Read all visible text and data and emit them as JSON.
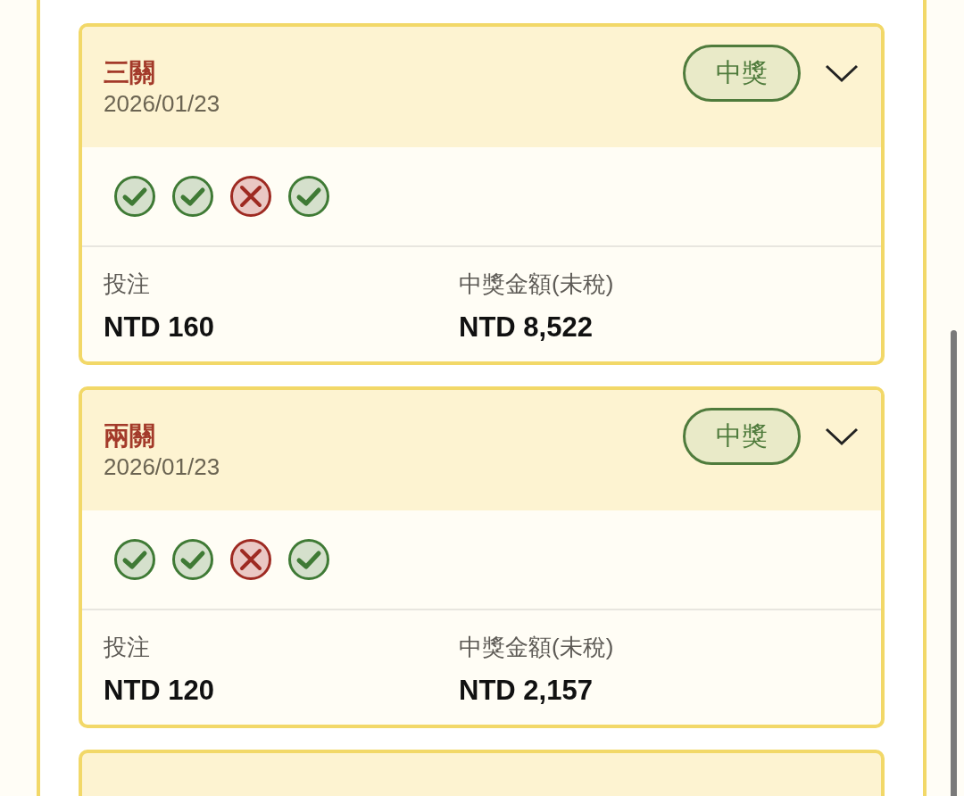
{
  "bets": [
    {
      "title": "三關",
      "date": "2026/01/23",
      "status": "中獎",
      "legs": [
        {
          "won": true
        },
        {
          "won": true
        },
        {
          "won": false
        },
        {
          "won": true
        }
      ],
      "stake_label": "投注",
      "stake": "NTD 160",
      "payout_label": "中獎金額(未稅)",
      "payout": "NTD 8,522"
    },
    {
      "title": "兩關",
      "date": "2026/01/23",
      "status": "中獎",
      "legs": [
        {
          "won": true
        },
        {
          "won": true
        },
        {
          "won": false
        },
        {
          "won": true
        }
      ],
      "stake_label": "投注",
      "stake": "NTD 120",
      "payout_label": "中獎金額(未稅)",
      "payout": "NTD 2,157"
    }
  ]
}
